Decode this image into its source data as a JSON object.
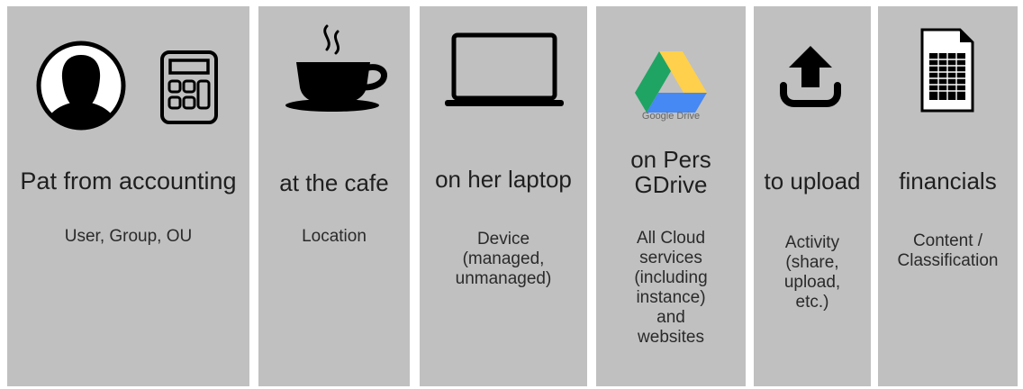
{
  "panels": [
    {
      "title": "Pat from accounting",
      "subtitle": "User, Group, OU",
      "icons": [
        "person-icon",
        "calculator-icon"
      ]
    },
    {
      "title": "at the cafe",
      "subtitle": "Location",
      "icons": [
        "coffee-cup-icon"
      ]
    },
    {
      "title": "on her laptop",
      "subtitle": "Device\n(managed,\nunmanaged)",
      "icons": [
        "laptop-icon"
      ]
    },
    {
      "title": "on Pers\nGDrive",
      "subtitle": "All Cloud\nservices\n(including\ninstance)\nand\nwebsites",
      "icons": [
        "google-drive-icon"
      ],
      "logo_caption": "Google Drive"
    },
    {
      "title": "to upload",
      "subtitle": "Activity\n(share,\nupload,\netc.)",
      "icons": [
        "upload-icon"
      ]
    },
    {
      "title": "financials",
      "subtitle": "Content /\nClassification",
      "icons": [
        "spreadsheet-document-icon"
      ]
    }
  ],
  "colors": {
    "panel_background": "#c0c0c0",
    "text": "#1f1f1f",
    "icon": "#000000",
    "drive_green": "#1fa463",
    "drive_yellow": "#ffd04b",
    "drive_blue": "#4688f4"
  }
}
